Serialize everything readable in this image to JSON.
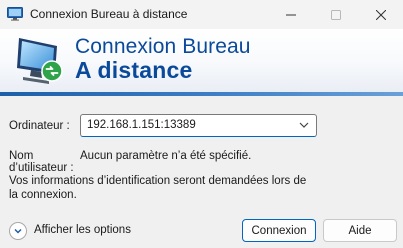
{
  "window": {
    "title": "Connexion Bureau à distance",
    "controls": {
      "minimize": "—",
      "maximize": "☐",
      "close": "✕"
    }
  },
  "banner": {
    "line1": "Connexion Bureau",
    "line2": "A distance",
    "icon": "remote-desktop-monitor-icon"
  },
  "form": {
    "computer_label": "Ordinateur :",
    "computer_value": "192.168.1.151:13389",
    "username_label_1": "Nom",
    "username_label_2": "d’utilisateur :",
    "username_value": "Aucun paramètre n’a été spécifié.",
    "info_text": "Vos informations d’identification seront demandées lors de la connexion."
  },
  "footer": {
    "options_label": "Afficher les options",
    "connect_label": "Connexion",
    "help_label": "Aide"
  },
  "colors": {
    "banner_text": "#0b4a9a",
    "stripe": "#1d5fa8",
    "accent": "#0067c0"
  }
}
